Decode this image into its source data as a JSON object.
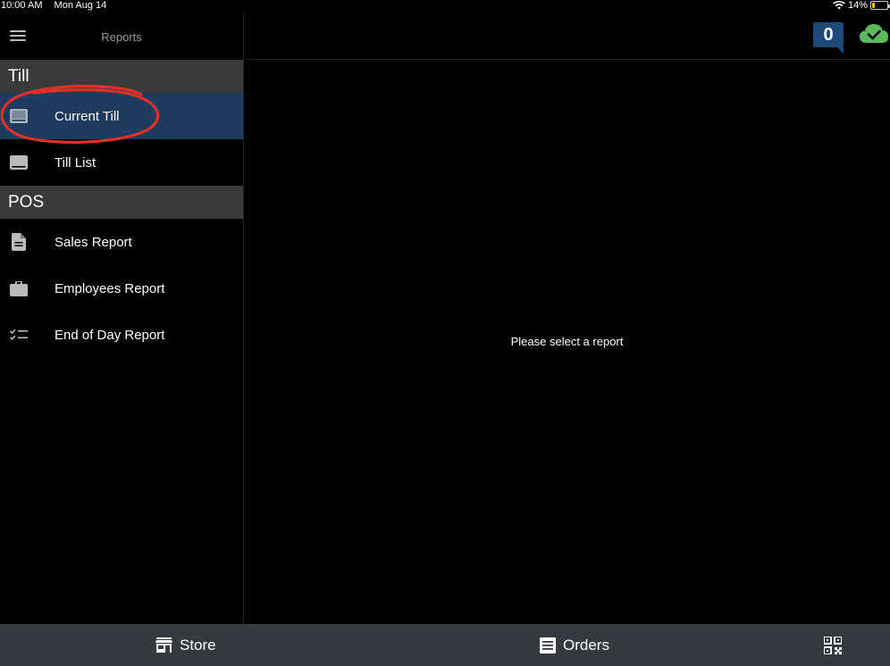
{
  "status": {
    "time": "10:00 AM",
    "date": "Mon Aug 14",
    "battery": "14%",
    "battery_level": 0.14
  },
  "sidebar": {
    "title": "Reports",
    "sections": [
      {
        "heading": "Till",
        "items": [
          {
            "label": "Current Till",
            "icon": "display-icon",
            "active": true
          },
          {
            "label": "Till List",
            "icon": "display-icon"
          }
        ]
      },
      {
        "heading": "POS",
        "items": [
          {
            "label": "Sales Report",
            "icon": "document-icon"
          },
          {
            "label": "Employees Report",
            "icon": "briefcase-icon"
          },
          {
            "label": "End of Day Report",
            "icon": "checklist-icon"
          }
        ]
      }
    ]
  },
  "topbar": {
    "count": "0",
    "sync_icon": "cloud-check-icon"
  },
  "main": {
    "message": "Please select a report"
  },
  "bottom": {
    "store_label": "Store",
    "orders_label": "Orders",
    "qr_icon": "qr-code-icon"
  },
  "colors": {
    "active": "#1e3a5c",
    "section": "#3a3a3a",
    "bottom_bar": "#353a40",
    "badge": "#1e4a7a",
    "cloud": "#5cb85c",
    "annotation": "#e0302a"
  }
}
